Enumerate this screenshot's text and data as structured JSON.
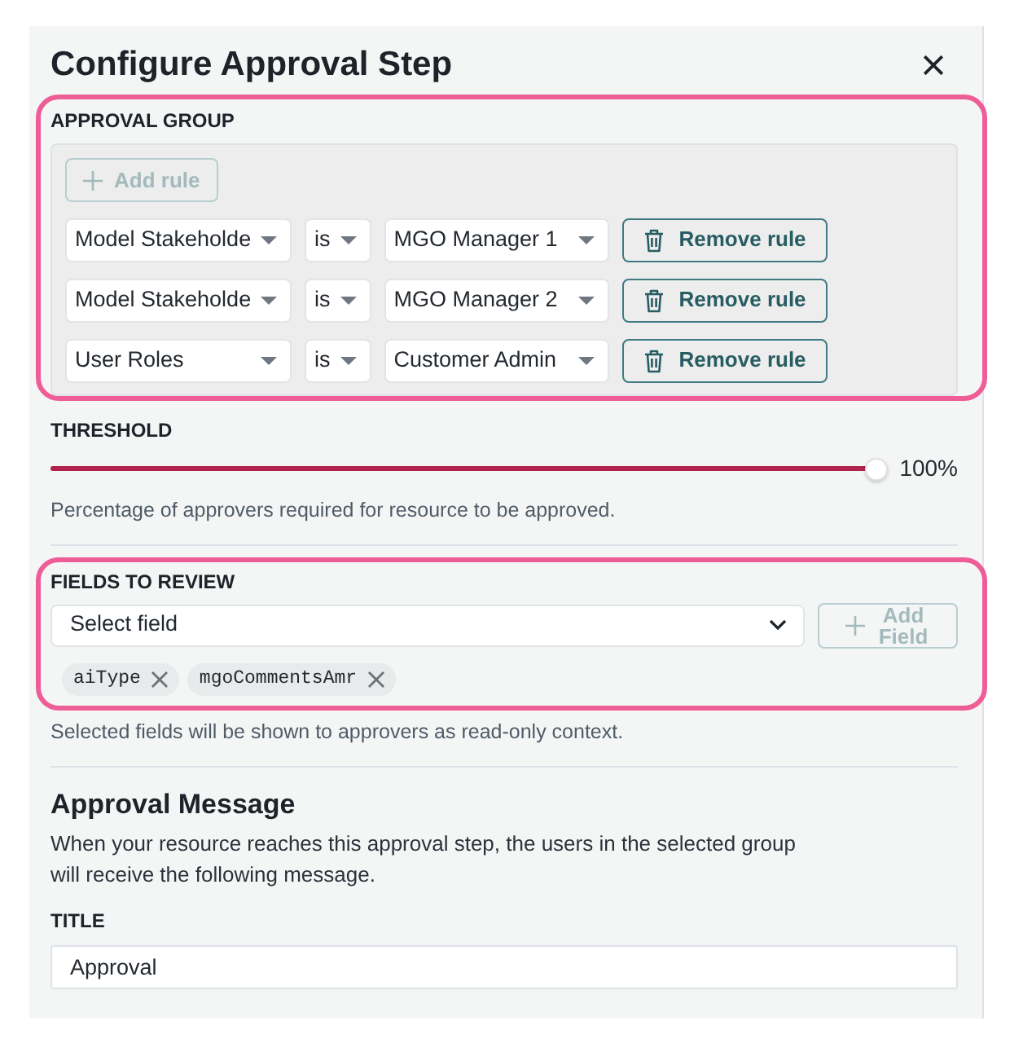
{
  "dialog": {
    "title": "Configure Approval Step"
  },
  "approval_group": {
    "label": "APPROVAL GROUP",
    "highlighted": true,
    "add_rule": {
      "label": "Add rule",
      "disabled": true
    },
    "rules": [
      {
        "field": "Model Stakeholde",
        "operator": "is",
        "value": "MGO Manager 1",
        "remove_label": "Remove rule"
      },
      {
        "field": "Model Stakeholde",
        "operator": "is",
        "value": "MGO Manager 2",
        "remove_label": "Remove rule"
      },
      {
        "field": "User Roles",
        "operator": "is",
        "value": "Customer Admin",
        "remove_label": "Remove rule"
      }
    ]
  },
  "threshold": {
    "label": "THRESHOLD",
    "level": 1,
    "reading": "100%",
    "help": "Percentage of approvers required for resource to be approved."
  },
  "fields_to_review": {
    "label": "FIELDS TO REVIEW",
    "highlighted": true,
    "select": {
      "placeholder": "Select field"
    },
    "add_field": {
      "label": "Add Field",
      "disabled": true
    },
    "chips": [
      {
        "label": "aiType"
      },
      {
        "label": "mgoCommentsAmr"
      }
    ],
    "help": "Selected fields will be shown to approvers as read-only context."
  },
  "approval_message": {
    "heading": "Approval Message",
    "description": "When your resource reaches this approval step, the users in the selected group will receive the following message.",
    "title_field": {
      "label": "TITLE",
      "value": "Approval"
    }
  }
}
